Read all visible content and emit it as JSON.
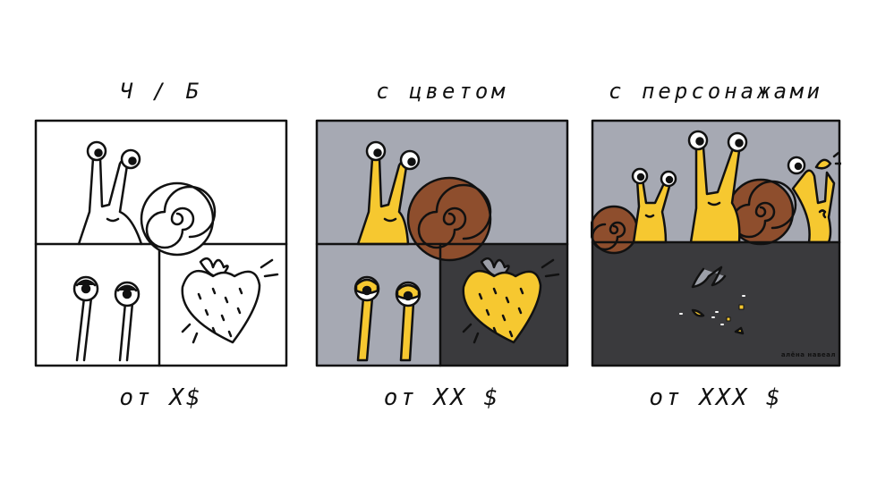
{
  "tiers": [
    {
      "title": "Ч / Б",
      "price": "от Х$"
    },
    {
      "title": "с цветом",
      "price": "от ХХ $"
    },
    {
      "title": "с персонажами",
      "price": "от ХХХ $"
    }
  ],
  "signature": "алёна навеал",
  "colors": {
    "yellow": "#F6C830",
    "brown": "#8E4E2D",
    "gray_bg": "#A6A9B3",
    "dark_bg": "#3A3A3D",
    "outline": "#111111",
    "wing_gray": "#9C9FA8"
  }
}
